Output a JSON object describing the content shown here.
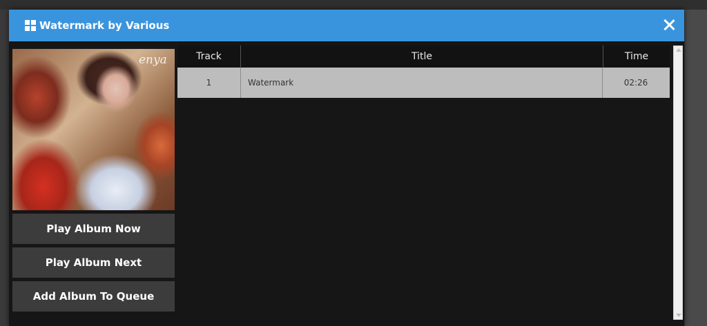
{
  "dialog": {
    "title": "Watermark by Various",
    "icon": "grid-icon",
    "close_icon": "close-icon",
    "accent_color": "#3a94dd"
  },
  "album": {
    "cover_signature": "enya"
  },
  "actions": [
    {
      "label": "Play Album Now"
    },
    {
      "label": "Play Album Next"
    },
    {
      "label": "Add Album To Queue"
    }
  ],
  "tracks": {
    "headers": {
      "track": "Track",
      "title": "Title",
      "time": "Time"
    },
    "rows": [
      {
        "track": "1",
        "title": "Watermark",
        "time": "02:26"
      }
    ]
  }
}
